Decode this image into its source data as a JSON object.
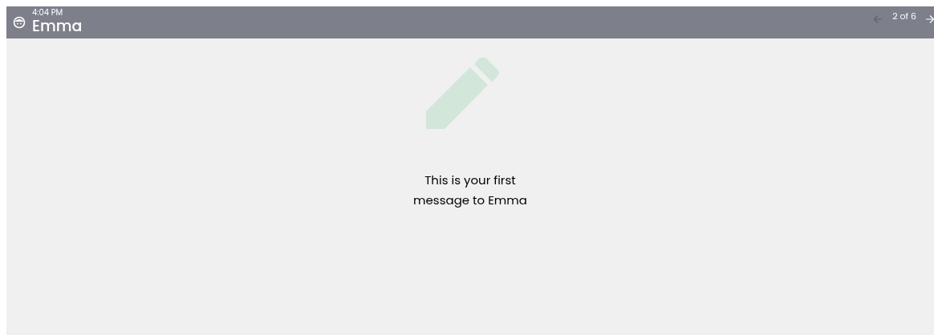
{
  "header": {
    "time": "4:04 PM",
    "name": "Emma",
    "counter": "2 of 6",
    "prev_disabled": true,
    "next_disabled": false
  },
  "empty_state": {
    "message": "This is your first message to Emma"
  }
}
